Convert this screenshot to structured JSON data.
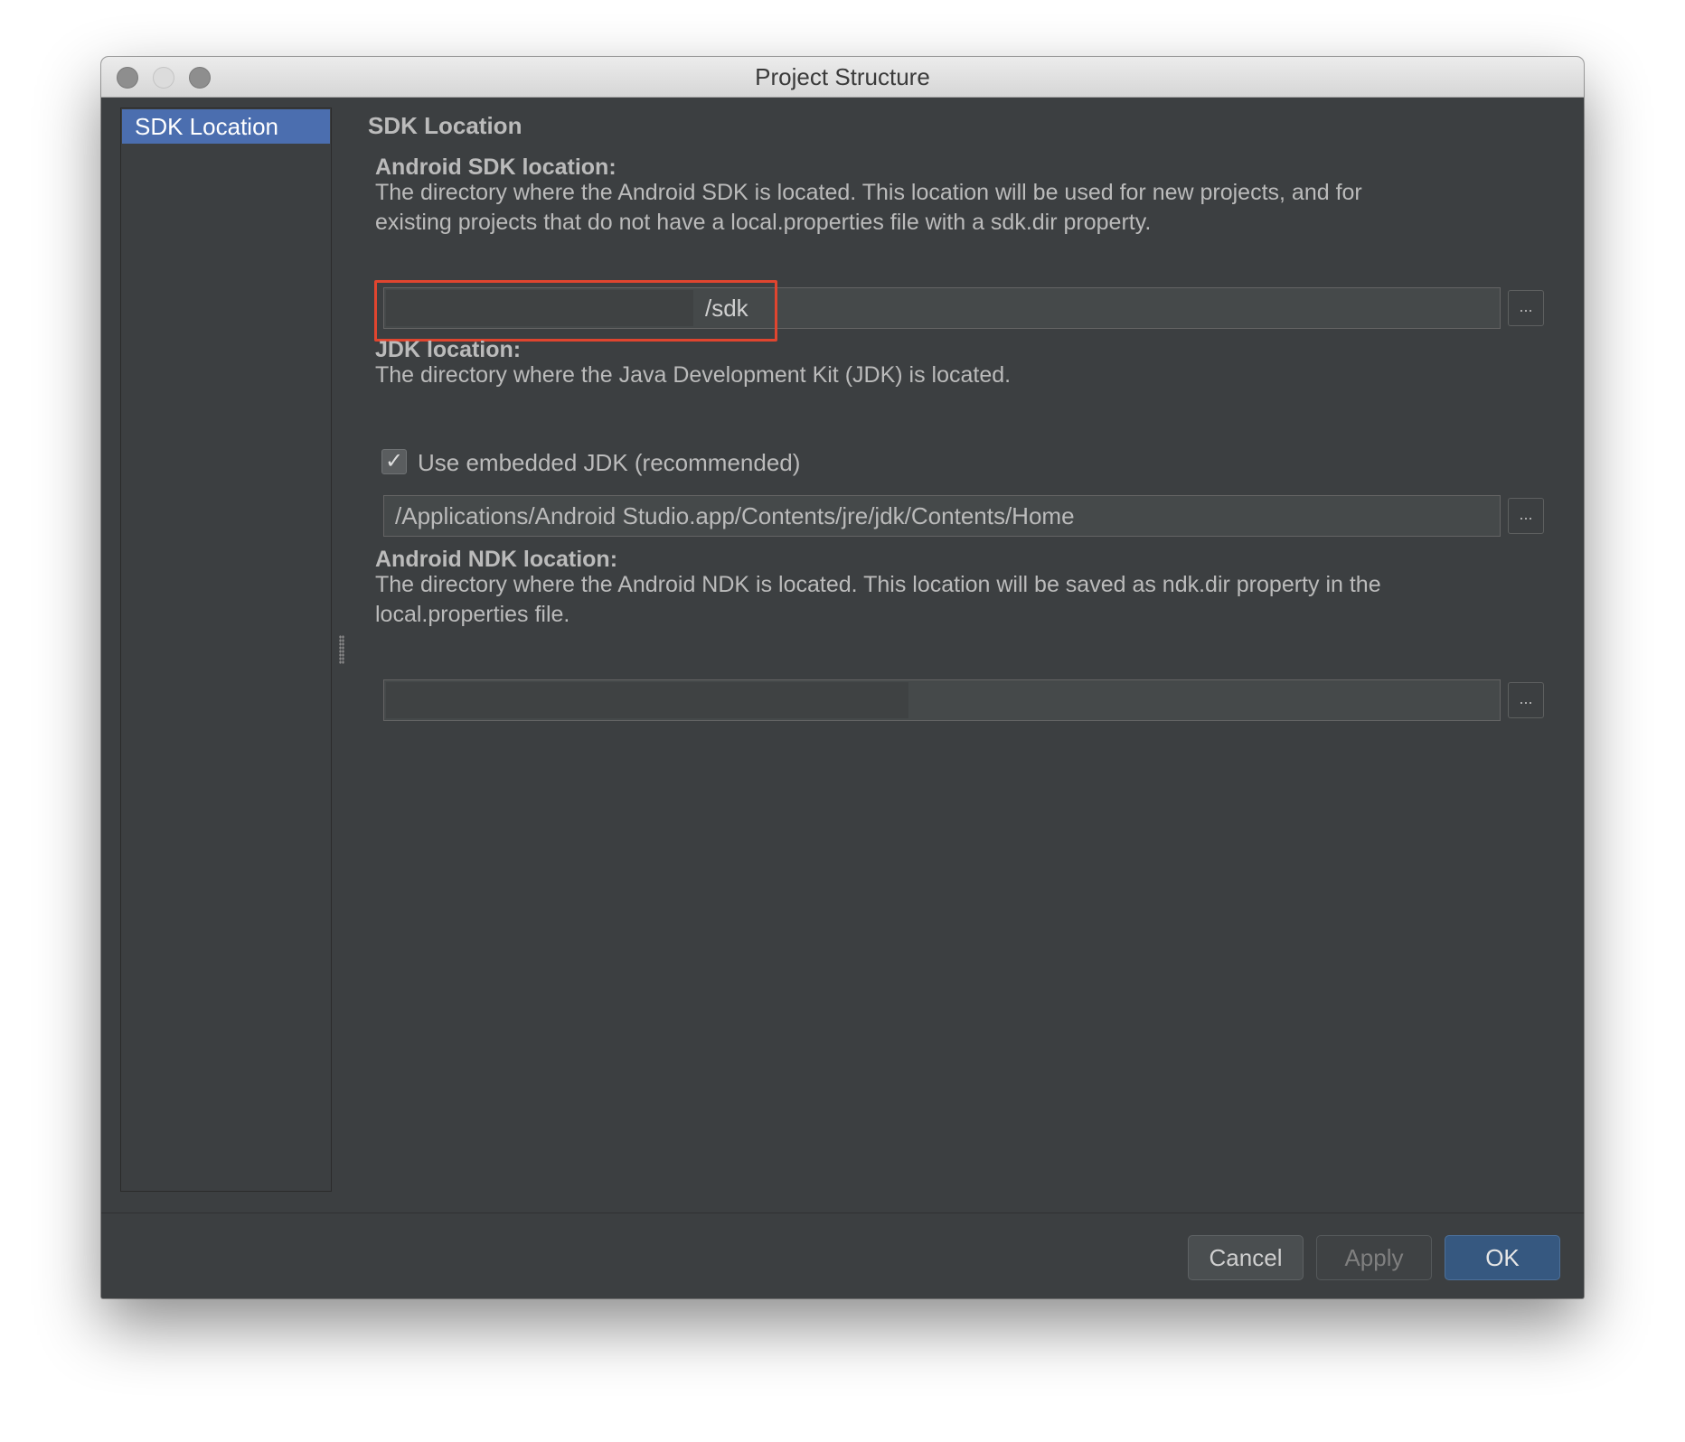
{
  "window": {
    "title": "Project Structure"
  },
  "sidebar": {
    "items": [
      {
        "label": "SDK Location",
        "selected": true
      }
    ]
  },
  "content": {
    "title": "SDK Location",
    "android_sdk": {
      "label": "Android SDK location:",
      "description_line1": "The directory where the Android SDK is located. This location will be used for new projects, and for",
      "description_line2": "existing projects that do not have a local.properties file with a sdk.dir property.",
      "value": "/sdk",
      "browse_label": "..."
    },
    "jdk": {
      "label": "JDK location:",
      "description": "The directory where the Java Development Kit (JDK) is located.",
      "use_embedded_label": "Use embedded JDK (recommended)",
      "use_embedded_checked": true,
      "checkmark": "✓",
      "value": "/Applications/Android Studio.app/Contents/jre/jdk/Contents/Home",
      "browse_label": "..."
    },
    "android_ndk": {
      "label": "Android NDK location:",
      "description_line1": "The directory where the Android NDK is located. This location will be saved as ndk.dir property in the",
      "description_line2": "local.properties file.",
      "value": "",
      "browse_label": "..."
    }
  },
  "footer": {
    "cancel_label": "Cancel",
    "apply_label": "Apply",
    "ok_label": "OK",
    "apply_enabled": false
  },
  "colors": {
    "selection": "#4b6eaf",
    "highlight_box": "#e0452f",
    "ok_button": "#365880"
  }
}
